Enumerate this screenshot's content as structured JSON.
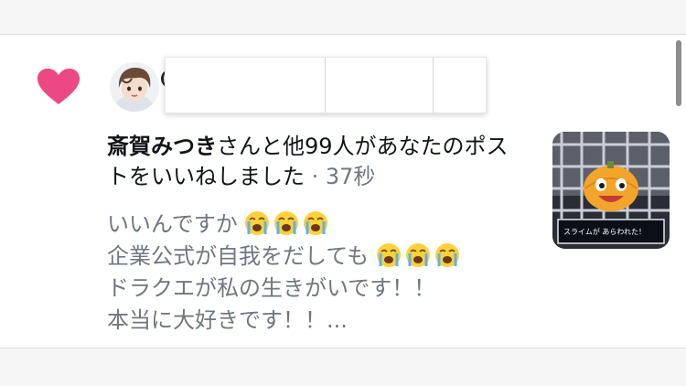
{
  "notification": {
    "actor_name": "斎賀みつき",
    "action_text": "さんと他99人があなたのポストをいいねしました",
    "separator": " · ",
    "time_ago": "37秒"
  },
  "post": {
    "lines": [
      "いいんですか",
      "企業公式が自我をだしても",
      "ドラクエが私の生きがいです！！",
      "本当に大好きです！！..."
    ]
  },
  "thumbnail": {
    "caption": "スライムが あらわれた！"
  },
  "icons": {
    "like": "heart-icon",
    "reaction": "loudly-crying-face-emoji"
  },
  "colors": {
    "heart": "#ec4884",
    "secondary_text": "#6b7884",
    "primary_text": "#0f1419"
  }
}
